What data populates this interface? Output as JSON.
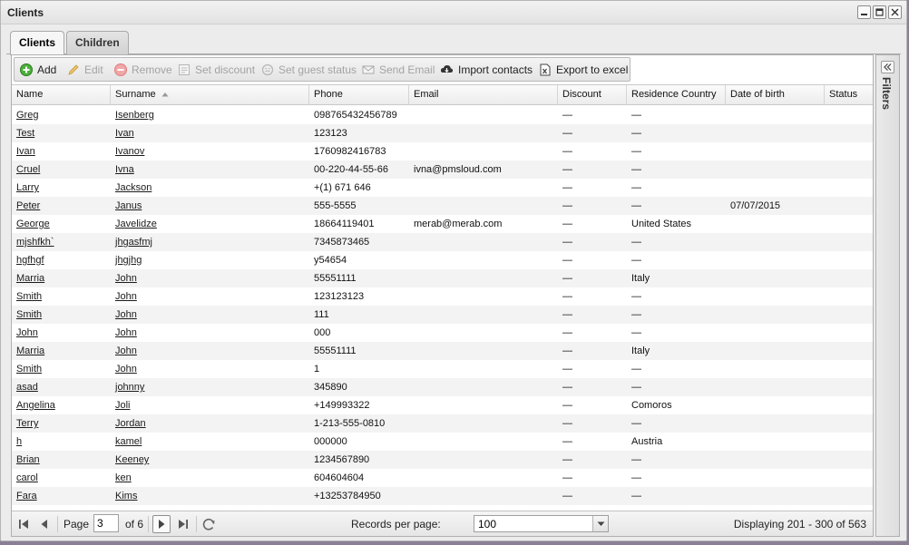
{
  "window": {
    "title": "Clients"
  },
  "tabs": [
    {
      "label": "Clients",
      "active": true
    },
    {
      "label": "Children",
      "active": false
    }
  ],
  "toolbar": {
    "add": "Add",
    "edit": "Edit",
    "remove": "Remove",
    "set_discount": "Set discount",
    "set_guest_status": "Set guest status",
    "send_email": "Send Email",
    "import_contacts": "Import contacts",
    "export_excel": "Export to excel"
  },
  "columns": [
    "Name",
    "Surname",
    "Phone",
    "Email",
    "Discount",
    "Residence Country",
    "Date of birth",
    "Status"
  ],
  "sort": {
    "column": "Surname",
    "direction": "asc"
  },
  "rows": [
    [
      "Greg",
      "Isenberg",
      "098765432456789",
      "",
      "—",
      "—",
      "",
      ""
    ],
    [
      "Test",
      "Ivan",
      "123123",
      "",
      "—",
      "—",
      "",
      ""
    ],
    [
      "Ivan",
      "Ivanov",
      "1760982416783",
      "",
      "—",
      "—",
      "",
      ""
    ],
    [
      "Cruel",
      "Ivna",
      "00-220-44-55-66",
      "ivna@pmsloud.com",
      "—",
      "—",
      "",
      ""
    ],
    [
      "Larry",
      "Jackson",
      "+(1) 671 646",
      "",
      "—",
      "—",
      "",
      ""
    ],
    [
      "Peter",
      "Janus",
      "555-5555",
      "",
      "—",
      "—",
      "07/07/2015",
      ""
    ],
    [
      "George",
      "Javelidze",
      "18664119401",
      "merab@merab.com",
      "—",
      "United States",
      "",
      ""
    ],
    [
      "mjshfkh`",
      "jhgasfmj",
      "7345873465",
      "",
      "—",
      "—",
      "",
      ""
    ],
    [
      "hgfhgf",
      "jhgjhg",
      "y54654",
      "",
      "—",
      "—",
      "",
      ""
    ],
    [
      "Marria",
      "John",
      "55551111",
      "",
      "—",
      "Italy",
      "",
      ""
    ],
    [
      "Smith",
      "John",
      "123123123",
      "",
      "—",
      "—",
      "",
      ""
    ],
    [
      "Smith",
      "John",
      "111",
      "",
      "—",
      "—",
      "",
      ""
    ],
    [
      "John",
      "John",
      "000",
      "",
      "—",
      "—",
      "",
      ""
    ],
    [
      "Marria",
      "John",
      "55551111",
      "",
      "—",
      "Italy",
      "",
      ""
    ],
    [
      "Smith",
      "John",
      "1",
      "",
      "—",
      "—",
      "",
      ""
    ],
    [
      "asad",
      "johnny",
      "345890",
      "",
      "—",
      "—",
      "",
      ""
    ],
    [
      "Angelina",
      "Joli",
      "+149993322",
      "",
      "—",
      "Comoros",
      "",
      ""
    ],
    [
      "Terry",
      "Jordan",
      "1-213-555-0810",
      "",
      "—",
      "—",
      "",
      ""
    ],
    [
      "h",
      "kamel",
      "000000",
      "",
      "—",
      "Austria",
      "",
      ""
    ],
    [
      "Brian",
      "Keeney",
      "1234567890",
      "",
      "—",
      "—",
      "",
      ""
    ],
    [
      "carol",
      "ken",
      "604604604",
      "",
      "—",
      "—",
      "",
      ""
    ],
    [
      "Fara",
      "Kims",
      "+13253784950",
      "",
      "—",
      "—",
      "",
      ""
    ]
  ],
  "pager": {
    "page_label": "Page",
    "page_value": "3",
    "of_label": "of 6",
    "records_label": "Records per page:",
    "records_value": "100",
    "display_text": "Displaying 201 - 300 of 563"
  },
  "filters": {
    "label": "Filters"
  }
}
